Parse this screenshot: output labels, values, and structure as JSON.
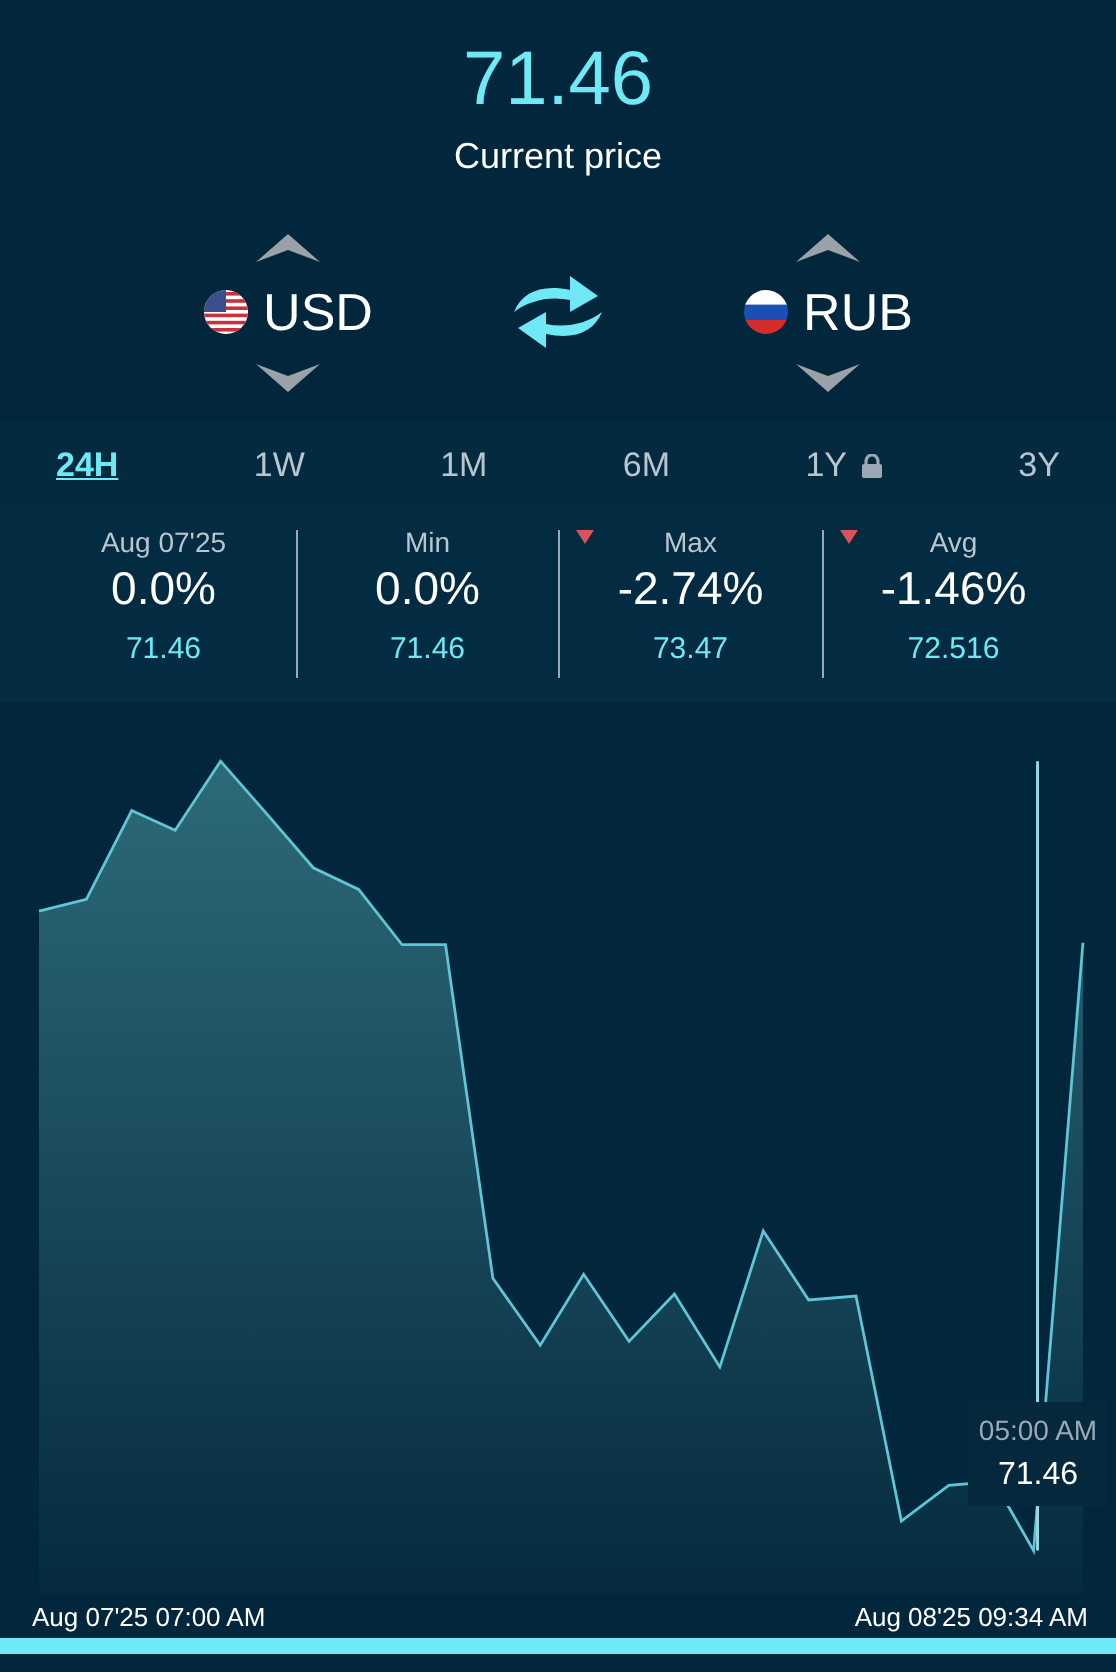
{
  "price": {
    "value": "71.46",
    "label": "Current price"
  },
  "pair": {
    "from": {
      "code": "USD"
    },
    "to": {
      "code": "RUB"
    }
  },
  "periods": [
    {
      "label": "24H",
      "selected": true,
      "locked": false
    },
    {
      "label": "1W",
      "selected": false,
      "locked": false
    },
    {
      "label": "1M",
      "selected": false,
      "locked": false
    },
    {
      "label": "6M",
      "selected": false,
      "locked": false
    },
    {
      "label": "1Y",
      "selected": false,
      "locked": true
    },
    {
      "label": "3Y",
      "selected": false,
      "locked": false
    }
  ],
  "stats": [
    {
      "label": "Aug 07'25",
      "change": "0.0%",
      "value": "71.46",
      "down": false
    },
    {
      "label": "Min",
      "change": "0.0%",
      "value": "71.46",
      "down": false
    },
    {
      "label": "Max",
      "change": "-2.74%",
      "value": "73.47",
      "down": true
    },
    {
      "label": "Avg",
      "change": "-1.46%",
      "value": "72.516",
      "down": true
    }
  ],
  "chart": {
    "tooltip": {
      "time": "05:00 AM",
      "value": "71.46"
    },
    "start_label": "Aug 07'25 07:00 AM",
    "end_label": "Aug 08'25 09:34 AM"
  }
}
